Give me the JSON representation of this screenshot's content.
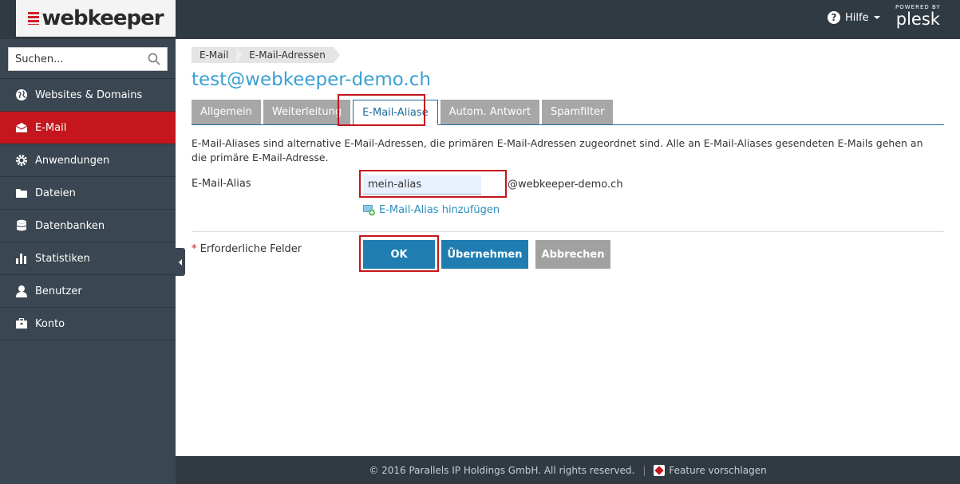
{
  "header": {
    "logo_text": "webkeeper",
    "help_label": "Hilfe",
    "powered_by": "POWERED BY",
    "plesk_label": "plesk"
  },
  "sidebar": {
    "search_placeholder": "Suchen...",
    "items": [
      {
        "label": "Websites & Domains",
        "icon": "globe-icon"
      },
      {
        "label": "E-Mail",
        "icon": "envelope-icon",
        "active": true
      },
      {
        "label": "Anwendungen",
        "icon": "gear-icon"
      },
      {
        "label": "Dateien",
        "icon": "folder-icon"
      },
      {
        "label": "Datenbanken",
        "icon": "database-icon"
      },
      {
        "label": "Statistiken",
        "icon": "bar-chart-icon"
      },
      {
        "label": "Benutzer",
        "icon": "user-icon"
      },
      {
        "label": "Konto",
        "icon": "briefcase-icon"
      }
    ]
  },
  "breadcrumb": [
    "E-Mail",
    "E-Mail-Adressen"
  ],
  "page_title": "test@webkeeper-demo.ch",
  "tabs": [
    {
      "label": "Allgemein"
    },
    {
      "label": "Weiterleitung"
    },
    {
      "label": "E-Mail-Aliase",
      "active": true
    },
    {
      "label": "Autom. Antwort"
    },
    {
      "label": "Spamfilter"
    }
  ],
  "description": "E-Mail-Aliases sind alternative E-Mail-Adressen, die primären E-Mail-Adressen zugeordnet sind. Alle an E-Mail-Aliases gesendeten E-Mails gehen an die primäre E-Mail-Adresse.",
  "form": {
    "alias_label": "E-Mail-Alias",
    "alias_value": "mein-alias",
    "domain_suffix": "@webkeeper-demo.ch",
    "add_alias_label": "E-Mail-Alias hinzufügen",
    "required_star": "*",
    "required_label": "Erforderliche Felder",
    "ok_label": "OK",
    "apply_label": "Übernehmen",
    "cancel_label": "Abbrechen"
  },
  "footer": {
    "copyright": "© 2016 Parallels IP Holdings GmbH. All rights reserved.",
    "separator": "|",
    "feature_label": "Feature vorschlagen"
  },
  "colors": {
    "accent_red": "#c4161c",
    "link_blue": "#3aa0d3",
    "button_blue": "#1f7db2",
    "sidebar_bg": "#3a4651",
    "topbar_bg": "#303a43"
  }
}
